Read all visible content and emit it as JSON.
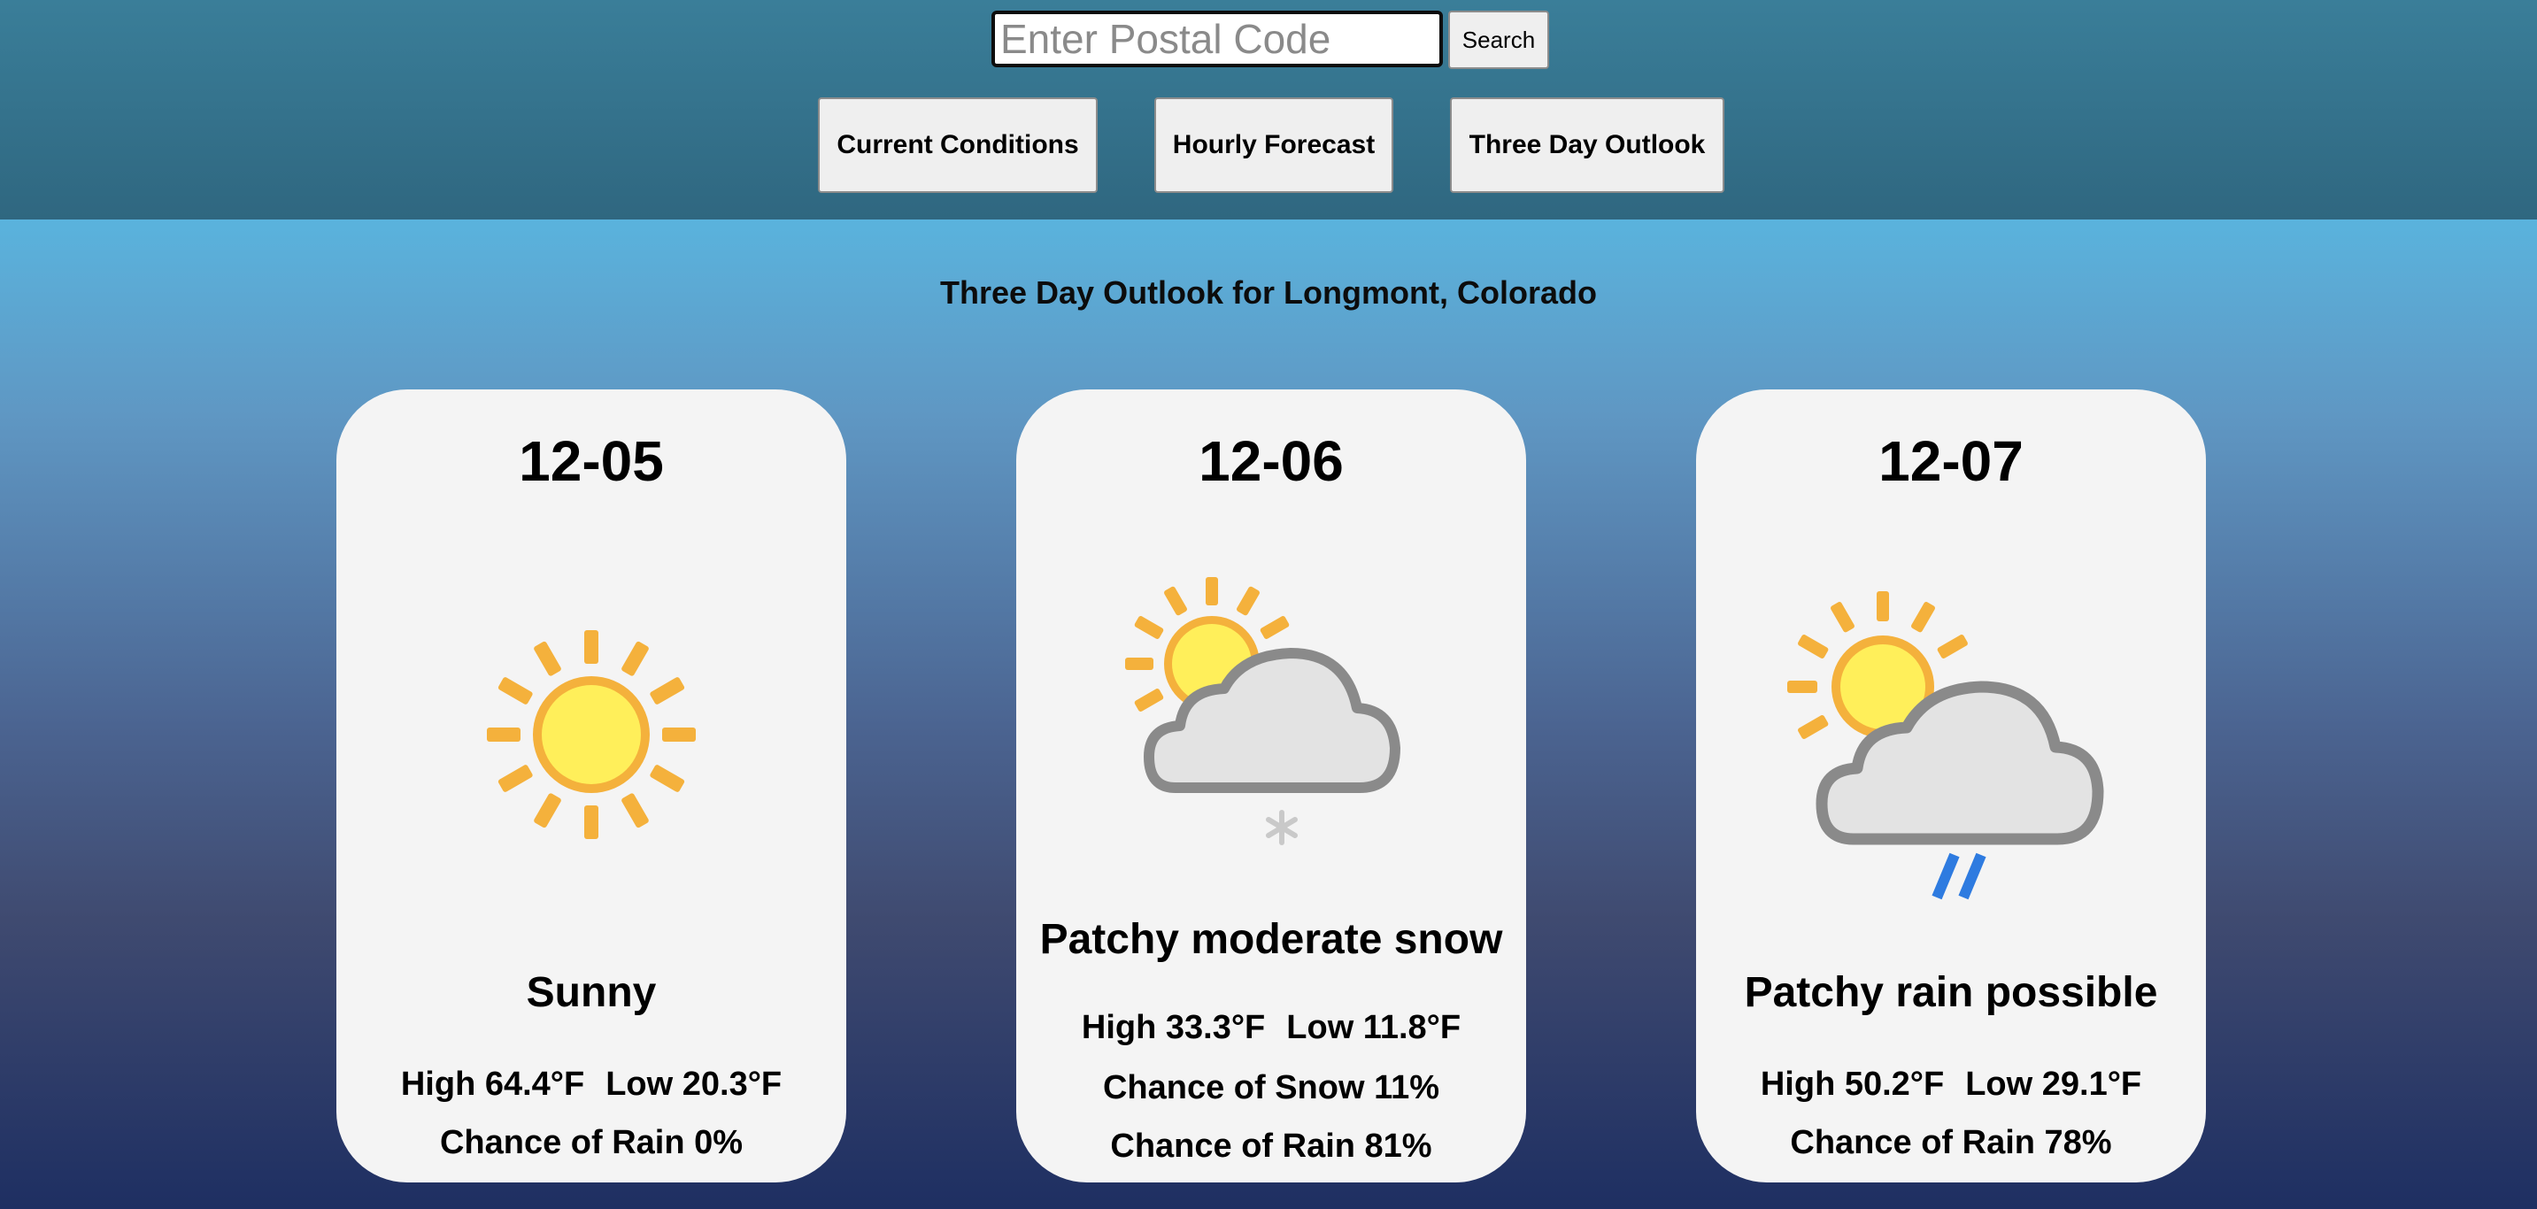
{
  "search": {
    "placeholder": "Enter Postal Code",
    "button_label": "Search"
  },
  "nav": {
    "current_label": "Current Conditions",
    "hourly_label": "Hourly Forecast",
    "three_day_label": "Three Day Outlook"
  },
  "page_title": "Three Day Outlook for Longmont, Colorado",
  "days": [
    {
      "date": "12-05",
      "icon": "sunny-icon",
      "condition": "Sunny",
      "high": "High 64.4°F",
      "low": "Low 20.3°F",
      "extra": [],
      "rain": "Chance of Rain 0%"
    },
    {
      "date": "12-06",
      "icon": "patchy-snow-icon",
      "condition": "Patchy moderate snow",
      "high": "High 33.3°F",
      "low": "Low 11.8°F",
      "extra": [
        "Chance of Snow 11%"
      ],
      "rain": "Chance of Rain 81%"
    },
    {
      "date": "12-07",
      "icon": "patchy-rain-icon",
      "condition": "Patchy rain possible",
      "high": "High 50.2°F",
      "low": "Low 29.1°F",
      "extra": [],
      "rain": "Chance of Rain 78%"
    }
  ],
  "colors": {
    "header": "#357590",
    "card": "#f4f4f4",
    "sun_yellow": "#ffef5a",
    "sun_orange": "#f4b13c",
    "cloud_gray": "#e0e0e0",
    "cloud_outline": "#8a8a8a",
    "rain_blue": "#2e7be0"
  }
}
